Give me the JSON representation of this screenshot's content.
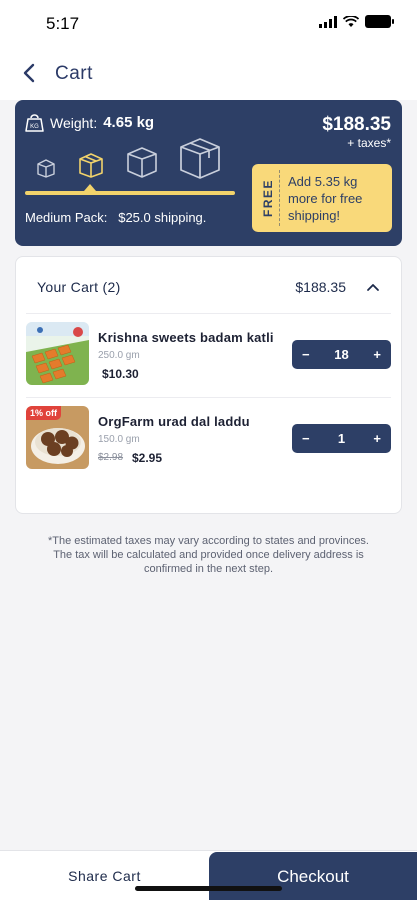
{
  "status_bar": {
    "time": "5:17"
  },
  "nav": {
    "title": "Cart"
  },
  "shipping": {
    "weight_label": "Weight:",
    "weight_value": "4.65 kg",
    "total": "$188.35",
    "taxes_note": "+ taxes*",
    "pack_name": "Medium Pack:",
    "pack_shipping": "$25.0 shipping.",
    "free_tag": "FREE",
    "free_message": "Add 5.35 kg more for free shipping!",
    "accent_color": "#f9d97a",
    "card_color": "#2d3f66"
  },
  "cart": {
    "header": "Your Cart",
    "count": "(2)",
    "total": "$188.35",
    "items": [
      {
        "name": "Krishna sweets badam katli",
        "weight": "250.0 gm",
        "price": "$10.30",
        "quantity": "18"
      },
      {
        "name": "OrgFarm urad dal laddu",
        "weight": "150.0 gm",
        "old_price": "$2.98",
        "price": "$2.95",
        "quantity": "1",
        "badge": "1% off"
      }
    ]
  },
  "disclaimer": "*The estimated taxes may vary according to states and provinces. The tax will be calculated and provided once delivery address is confirmed in the next step.",
  "bottom": {
    "share_label": "Share Cart",
    "checkout_label": "Checkout"
  }
}
